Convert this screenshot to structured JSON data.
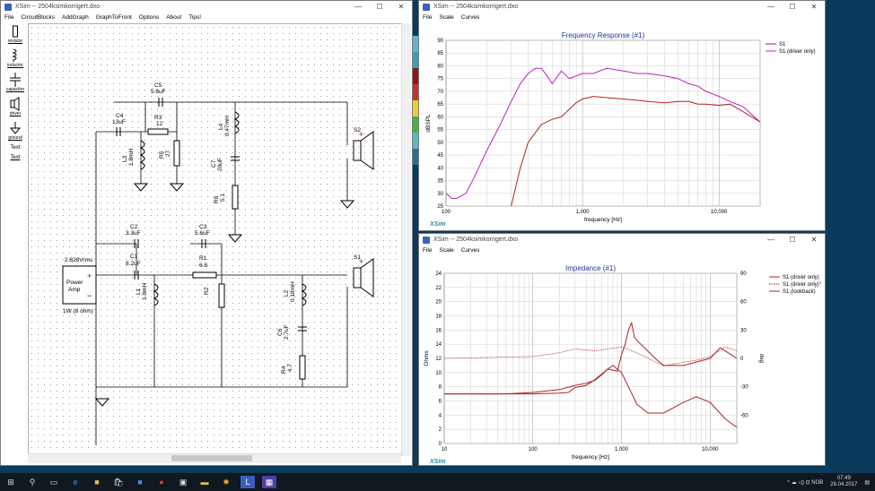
{
  "app": {
    "desktop_color": "#0b3a5a"
  },
  "schematic_window": {
    "title": "XSim -- 2504ksimkorrigert.dxo",
    "menu": [
      "File",
      "CircuitBlocks",
      "AddGraph",
      "GraphToFront",
      "Options",
      "About",
      "Tips!"
    ],
    "palette": [
      {
        "label": "resistor",
        "icon": "resistor-icon"
      },
      {
        "label": "inductor",
        "icon": "inductor-icon"
      },
      {
        "label": "capacitor",
        "icon": "capacitor-icon"
      },
      {
        "label": "driver",
        "icon": "driver-icon"
      },
      {
        "label": "ground",
        "icon": "ground-icon"
      },
      {
        "label": "Text",
        "icon": ""
      },
      {
        "label": "Text",
        "icon": ""
      }
    ],
    "components": {
      "c5": {
        "name": "C5",
        "value": "5.6uF"
      },
      "c4": {
        "name": "C4",
        "value": "13uF"
      },
      "r3": {
        "name": "R3",
        "value": "12"
      },
      "l3": {
        "name": "L3",
        "value": "1.8mH"
      },
      "r5": {
        "name": "R5",
        "value": "27"
      },
      "l4": {
        "name": "L4",
        "value": "0.47mH"
      },
      "c7": {
        "name": "C7",
        "value": "20uF"
      },
      "r6": {
        "name": "R6",
        "value": "5.1"
      },
      "s2": {
        "name": "S2"
      },
      "c2": {
        "name": "C2",
        "value": "3.3uF"
      },
      "c3": {
        "name": "C3",
        "value": "5.6uF"
      },
      "c1": {
        "name": "C1",
        "value": "8.2uF"
      },
      "r1": {
        "name": "R1",
        "value": "6.8"
      },
      "l1": {
        "name": "L1",
        "value": "1.8mH"
      },
      "r2": {
        "name": "R2",
        "value": ""
      },
      "l2": {
        "name": "L2",
        "value": "0.18mH"
      },
      "c6": {
        "name": "C6",
        "value": "2.7uF"
      },
      "r4": {
        "name": "R4",
        "value": "4.7"
      },
      "s1": {
        "name": "S1"
      },
      "amp": {
        "voltage": "2.828Vrms",
        "label_line1": "Power",
        "label_line2": "Amp",
        "power": "1W (8 ohm)",
        "plus": "+",
        "minus": "−"
      }
    }
  },
  "freq_window": {
    "title": "XSim -- 2504ksimkorrigert.dxo",
    "menu": [
      "File",
      "Scale",
      "Curves"
    ],
    "chart_data": {
      "type": "line",
      "title": "Frequency Response (#1)",
      "xlabel": "frequency [Hz]",
      "ylabel": "dBSPL",
      "x_scale": "log",
      "xlim": [
        100,
        20000
      ],
      "ylim": [
        25,
        90
      ],
      "xticks": [
        {
          "v": 100,
          "t": "100"
        },
        {
          "v": 1000,
          "t": "1,000"
        },
        {
          "v": 10000,
          "t": "10,000"
        }
      ],
      "yticks": [
        25,
        30,
        35,
        40,
        45,
        50,
        55,
        60,
        65,
        70,
        75,
        80,
        85,
        90
      ],
      "grid": true,
      "legend_placement": "right",
      "brand": "XSim",
      "series": [
        {
          "name": "S1",
          "color": "#b22222",
          "x": [
            300,
            350,
            400,
            500,
            600,
            700,
            800,
            900,
            1000,
            1200,
            1500,
            2000,
            2500,
            3000,
            4000,
            5000,
            6000,
            7000,
            8000,
            10000,
            12000,
            15000,
            20000
          ],
          "y": [
            25,
            40,
            50,
            57,
            59,
            60,
            63,
            65.5,
            67,
            68,
            67.5,
            67,
            66.5,
            66,
            65.5,
            66,
            66,
            65,
            65,
            64.5,
            65,
            62,
            58
          ]
        },
        {
          "name": "S1 (driver only)",
          "color": "#c020c0",
          "x": [
            100,
            110,
            120,
            140,
            160,
            200,
            250,
            300,
            350,
            400,
            450,
            500,
            550,
            600,
            700,
            800,
            1000,
            1200,
            1500,
            2000,
            2500,
            3000,
            4000,
            5000,
            6000,
            7000,
            8000,
            10000,
            12000,
            15000,
            20000
          ],
          "y": [
            30,
            28,
            28,
            30,
            36,
            47,
            57,
            66,
            73,
            77,
            79,
            79,
            76,
            73,
            78,
            75,
            77,
            77,
            79,
            78,
            77,
            77,
            76,
            75,
            73,
            72,
            70,
            68,
            66,
            64,
            58
          ]
        }
      ]
    }
  },
  "imp_window": {
    "title": "XSim -- 2504ksimkorrigert.dxo",
    "menu": [
      "File",
      "Scale",
      "Curves"
    ],
    "chart_data": {
      "type": "line",
      "title": "Impedance (#1)",
      "xlabel": "frequency [Hz]",
      "ylabel": "Ohms",
      "y2label": "deg",
      "x_scale": "log",
      "xlim": [
        10,
        20000
      ],
      "ylim": [
        0,
        24
      ],
      "y2lim": [
        -90,
        90
      ],
      "xticks": [
        {
          "v": 10,
          "t": "10"
        },
        {
          "v": 100,
          "t": "100"
        },
        {
          "v": 1000,
          "t": "1,000"
        },
        {
          "v": 10000,
          "t": "10,000"
        }
      ],
      "yticks": [
        0,
        2,
        4,
        6,
        8,
        10,
        12,
        14,
        16,
        18,
        20,
        22,
        24
      ],
      "y2ticks": [
        -60,
        -30,
        0,
        30,
        60,
        90
      ],
      "grid": true,
      "legend_placement": "right",
      "brand": "XSim",
      "series": [
        {
          "name": "S1 (driver only)",
          "color": "#b22222",
          "axis": "left",
          "x": [
            10,
            50,
            100,
            200,
            300,
            400,
            500,
            600,
            700,
            800,
            1000,
            1200,
            1500,
            2000,
            3000,
            5000,
            7000,
            10000,
            15000,
            20000
          ],
          "y": [
            7,
            7,
            7.2,
            7.6,
            8.2,
            8.5,
            8.9,
            9.7,
            10.5,
            11,
            10,
            8,
            5.5,
            4.3,
            4.3,
            5.8,
            6.6,
            5.8,
            3.4,
            2.3
          ]
        },
        {
          "name": "S1 (driver only)°",
          "color": "#b22222",
          "axis": "right",
          "dotted": true,
          "x": [
            10,
            100,
            200,
            300,
            500,
            700,
            1000,
            1500,
            2000,
            3000,
            5000,
            7000,
            10000,
            15000,
            20000
          ],
          "y": [
            0,
            2,
            6,
            10,
            8,
            10,
            12,
            6,
            0,
            -8,
            -4,
            -2,
            2,
            12,
            8
          ]
        },
        {
          "name": "S1 (lookback)",
          "color": "#b22222",
          "axis": "left",
          "x": [
            10,
            50,
            100,
            200,
            250,
            300,
            400,
            500,
            700,
            900,
            1000,
            1100,
            1200,
            1300,
            1400,
            1500,
            2000,
            2500,
            3000,
            4000,
            5000,
            7000,
            10000,
            13000,
            15000,
            20000
          ],
          "y": [
            7,
            7,
            7,
            7.1,
            7.2,
            7.9,
            8.2,
            9,
            10.5,
            10.2,
            12.5,
            14,
            16,
            17,
            15,
            14.5,
            13,
            11.8,
            11,
            11,
            11,
            11.5,
            12,
            13.5,
            13,
            12
          ]
        }
      ]
    }
  }
}
